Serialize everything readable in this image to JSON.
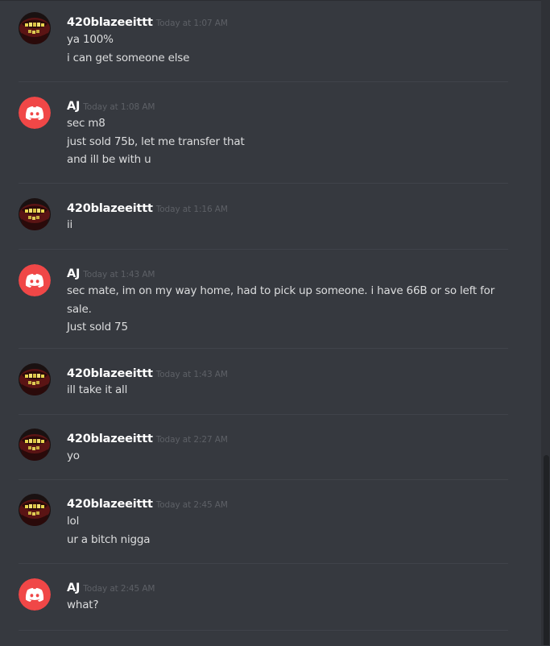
{
  "messages": [
    {
      "author": "420blazeeittt",
      "avatar": "skull-mouth-avatar",
      "time": "Today at 1:07 AM",
      "lines": [
        "ya 100%",
        "i can get someone else"
      ]
    },
    {
      "author": "AJ",
      "avatar": "discord-logo-avatar",
      "time": "Today at 1:08 AM",
      "lines": [
        "sec m8",
        "just sold 75b, let me transfer that",
        "and ill be with u"
      ]
    },
    {
      "author": "420blazeeittt",
      "avatar": "skull-mouth-avatar",
      "time": "Today at 1:16 AM",
      "lines": [
        "ii"
      ]
    },
    {
      "author": "AJ",
      "avatar": "discord-logo-avatar",
      "time": "Today at 1:43 AM",
      "lines": [
        "sec mate, im on my way home, had to pick up someone. i have 66B or so left for",
        "sale.",
        "Just sold 75"
      ]
    },
    {
      "author": "420blazeeittt",
      "avatar": "skull-mouth-avatar",
      "time": "Today at 1:43 AM",
      "lines": [
        "ill take it all"
      ]
    },
    {
      "author": "420blazeeittt",
      "avatar": "skull-mouth-avatar",
      "time": "Today at 2:27 AM",
      "lines": [
        "yo"
      ]
    },
    {
      "author": "420blazeeittt",
      "avatar": "skull-mouth-avatar",
      "time": "Today at 2:45 AM",
      "lines": [
        "lol",
        "ur a bitch nigga"
      ]
    },
    {
      "author": "AJ",
      "avatar": "discord-logo-avatar",
      "time": "Today at 2:45 AM",
      "lines": [
        "what?"
      ]
    }
  ],
  "colors": {
    "background": "#36393f",
    "discord_red": "#f04747",
    "username": "#ffffff",
    "message_text": "#dcddde",
    "timestamp": "#5d6066"
  }
}
